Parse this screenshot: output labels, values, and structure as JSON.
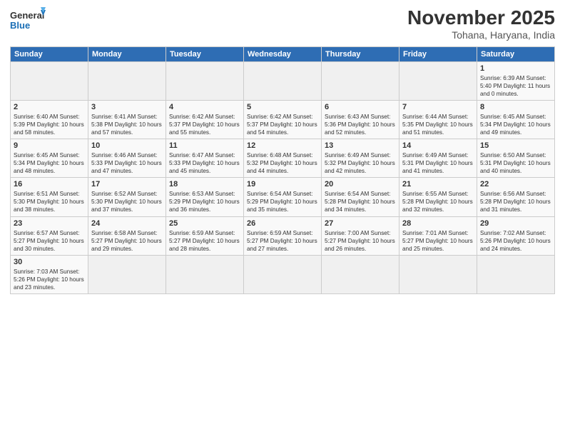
{
  "logo": {
    "text_general": "General",
    "text_blue": "Blue"
  },
  "header": {
    "title": "November 2025",
    "subtitle": "Tohana, Haryana, India"
  },
  "weekdays": [
    "Sunday",
    "Monday",
    "Tuesday",
    "Wednesday",
    "Thursday",
    "Friday",
    "Saturday"
  ],
  "weeks": [
    [
      {
        "day": "",
        "info": ""
      },
      {
        "day": "",
        "info": ""
      },
      {
        "day": "",
        "info": ""
      },
      {
        "day": "",
        "info": ""
      },
      {
        "day": "",
        "info": ""
      },
      {
        "day": "",
        "info": ""
      },
      {
        "day": "1",
        "info": "Sunrise: 6:39 AM\nSunset: 5:40 PM\nDaylight: 11 hours\nand 0 minutes."
      }
    ],
    [
      {
        "day": "2",
        "info": "Sunrise: 6:40 AM\nSunset: 5:39 PM\nDaylight: 10 hours\nand 58 minutes."
      },
      {
        "day": "3",
        "info": "Sunrise: 6:41 AM\nSunset: 5:38 PM\nDaylight: 10 hours\nand 57 minutes."
      },
      {
        "day": "4",
        "info": "Sunrise: 6:42 AM\nSunset: 5:37 PM\nDaylight: 10 hours\nand 55 minutes."
      },
      {
        "day": "5",
        "info": "Sunrise: 6:42 AM\nSunset: 5:37 PM\nDaylight: 10 hours\nand 54 minutes."
      },
      {
        "day": "6",
        "info": "Sunrise: 6:43 AM\nSunset: 5:36 PM\nDaylight: 10 hours\nand 52 minutes."
      },
      {
        "day": "7",
        "info": "Sunrise: 6:44 AM\nSunset: 5:35 PM\nDaylight: 10 hours\nand 51 minutes."
      },
      {
        "day": "8",
        "info": "Sunrise: 6:45 AM\nSunset: 5:34 PM\nDaylight: 10 hours\nand 49 minutes."
      }
    ],
    [
      {
        "day": "9",
        "info": "Sunrise: 6:45 AM\nSunset: 5:34 PM\nDaylight: 10 hours\nand 48 minutes."
      },
      {
        "day": "10",
        "info": "Sunrise: 6:46 AM\nSunset: 5:33 PM\nDaylight: 10 hours\nand 47 minutes."
      },
      {
        "day": "11",
        "info": "Sunrise: 6:47 AM\nSunset: 5:33 PM\nDaylight: 10 hours\nand 45 minutes."
      },
      {
        "day": "12",
        "info": "Sunrise: 6:48 AM\nSunset: 5:32 PM\nDaylight: 10 hours\nand 44 minutes."
      },
      {
        "day": "13",
        "info": "Sunrise: 6:49 AM\nSunset: 5:32 PM\nDaylight: 10 hours\nand 42 minutes."
      },
      {
        "day": "14",
        "info": "Sunrise: 6:49 AM\nSunset: 5:31 PM\nDaylight: 10 hours\nand 41 minutes."
      },
      {
        "day": "15",
        "info": "Sunrise: 6:50 AM\nSunset: 5:31 PM\nDaylight: 10 hours\nand 40 minutes."
      }
    ],
    [
      {
        "day": "16",
        "info": "Sunrise: 6:51 AM\nSunset: 5:30 PM\nDaylight: 10 hours\nand 38 minutes."
      },
      {
        "day": "17",
        "info": "Sunrise: 6:52 AM\nSunset: 5:30 PM\nDaylight: 10 hours\nand 37 minutes."
      },
      {
        "day": "18",
        "info": "Sunrise: 6:53 AM\nSunset: 5:29 PM\nDaylight: 10 hours\nand 36 minutes."
      },
      {
        "day": "19",
        "info": "Sunrise: 6:54 AM\nSunset: 5:29 PM\nDaylight: 10 hours\nand 35 minutes."
      },
      {
        "day": "20",
        "info": "Sunrise: 6:54 AM\nSunset: 5:28 PM\nDaylight: 10 hours\nand 34 minutes."
      },
      {
        "day": "21",
        "info": "Sunrise: 6:55 AM\nSunset: 5:28 PM\nDaylight: 10 hours\nand 32 minutes."
      },
      {
        "day": "22",
        "info": "Sunrise: 6:56 AM\nSunset: 5:28 PM\nDaylight: 10 hours\nand 31 minutes."
      }
    ],
    [
      {
        "day": "23",
        "info": "Sunrise: 6:57 AM\nSunset: 5:27 PM\nDaylight: 10 hours\nand 30 minutes."
      },
      {
        "day": "24",
        "info": "Sunrise: 6:58 AM\nSunset: 5:27 PM\nDaylight: 10 hours\nand 29 minutes."
      },
      {
        "day": "25",
        "info": "Sunrise: 6:59 AM\nSunset: 5:27 PM\nDaylight: 10 hours\nand 28 minutes."
      },
      {
        "day": "26",
        "info": "Sunrise: 6:59 AM\nSunset: 5:27 PM\nDaylight: 10 hours\nand 27 minutes."
      },
      {
        "day": "27",
        "info": "Sunrise: 7:00 AM\nSunset: 5:27 PM\nDaylight: 10 hours\nand 26 minutes."
      },
      {
        "day": "28",
        "info": "Sunrise: 7:01 AM\nSunset: 5:27 PM\nDaylight: 10 hours\nand 25 minutes."
      },
      {
        "day": "29",
        "info": "Sunrise: 7:02 AM\nSunset: 5:26 PM\nDaylight: 10 hours\nand 24 minutes."
      }
    ],
    [
      {
        "day": "30",
        "info": "Sunrise: 7:03 AM\nSunset: 5:26 PM\nDaylight: 10 hours\nand 23 minutes."
      },
      {
        "day": "",
        "info": ""
      },
      {
        "day": "",
        "info": ""
      },
      {
        "day": "",
        "info": ""
      },
      {
        "day": "",
        "info": ""
      },
      {
        "day": "",
        "info": ""
      },
      {
        "day": "",
        "info": ""
      }
    ]
  ]
}
